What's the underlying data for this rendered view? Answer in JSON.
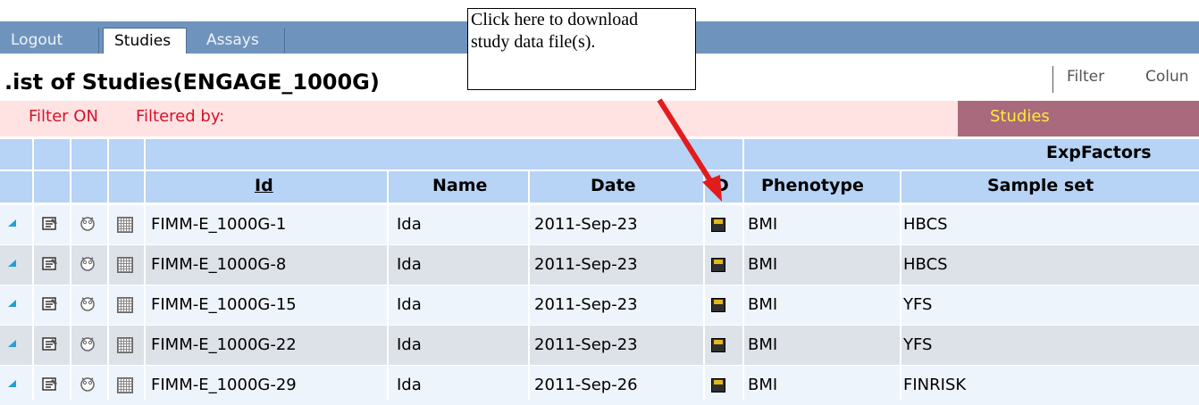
{
  "nav": {
    "tabs": [
      {
        "label": "Logout",
        "active": false
      },
      {
        "label": "Studies",
        "active": true
      },
      {
        "label": "Assays",
        "active": false
      }
    ]
  },
  "page": {
    "title": ".ist of Studies(ENGAGE_1000G)",
    "tools": [
      "Filter",
      "Colun"
    ]
  },
  "filter": {
    "status": "Filter ON",
    "filtered_by": "Filtered by:",
    "studies_label": "Studies"
  },
  "table": {
    "group_header": "ExpFactors",
    "columns": [
      "Id",
      "Name",
      "Date",
      "D",
      "Phenotype",
      "Sample set"
    ],
    "rows": [
      {
        "id": "FIMM-E_1000G-1",
        "name": "Ida",
        "date": "2011-Sep-23",
        "phenotype": "BMI",
        "sample_set": "HBCS"
      },
      {
        "id": "FIMM-E_1000G-8",
        "name": "Ida",
        "date": "2011-Sep-23",
        "phenotype": "BMI",
        "sample_set": "HBCS"
      },
      {
        "id": "FIMM-E_1000G-15",
        "name": "Ida",
        "date": "2011-Sep-23",
        "phenotype": "BMI",
        "sample_set": "YFS"
      },
      {
        "id": "FIMM-E_1000G-22",
        "name": "Ida",
        "date": "2011-Sep-23",
        "phenotype": "BMI",
        "sample_set": "YFS"
      },
      {
        "id": "FIMM-E_1000G-29",
        "name": "Ida",
        "date": "2011-Sep-26",
        "phenotype": "BMI",
        "sample_set": "FINRISK"
      }
    ],
    "row_colors": [
      "#eef4fc",
      "#dde1e8"
    ]
  },
  "tooltip": {
    "text_line1": "Click here to download",
    "text_line2": "study data file(s)."
  },
  "colors": {
    "nav": "#6e94bd",
    "filter_bg": "#ffe3e3",
    "filter_text": "#d6122a",
    "studies_bg": "#a86a7c",
    "studies_text": "#ffea3a",
    "header_bg": "#b7d3f5",
    "arrow": "#e21c1c"
  }
}
